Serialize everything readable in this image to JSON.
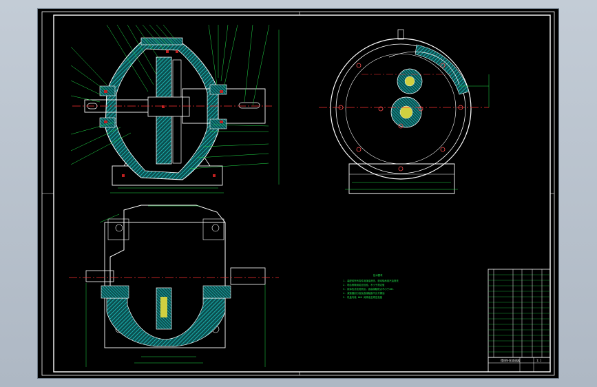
{
  "colors": {
    "background": "#000000",
    "frame": "#ffffff",
    "outline": "#ffffff",
    "hatch": "#1fc9c9",
    "centerline": "#ff3030",
    "dimension": "#22e04a",
    "part": "#d0d040"
  },
  "notes": {
    "heading": "技术要求",
    "lines": [
      "1. 装配前所有零件用煤油清洗，滚动轴承用汽油清洗",
      "2. 啮合侧隙用铅丝检验，不小于规定值",
      "3. 用涂色法检验斑点，齿高接触斑点不小于40%",
      "4. 减速器剖分面及各接触面不允许漏油",
      "5. 机盖内装 N68 润滑油至规定高度"
    ]
  },
  "title_block": {
    "title": "摆线针轮减速器",
    "scale": "1:1"
  }
}
